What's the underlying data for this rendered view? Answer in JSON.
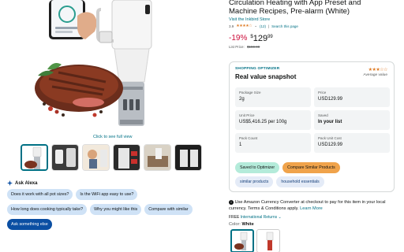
{
  "gallery": {
    "see_full_view": "Click to see full view",
    "thumbnail_count": 6
  },
  "ask": {
    "title": "Ask Alexa",
    "chips": [
      "Does it work with all pot sizes?",
      "Is the WiFi app easy to use?",
      "How long does cooking typically take?",
      "Why you might like this",
      "Compare with similar",
      "Ask something else"
    ]
  },
  "product": {
    "title_line1": "Circulation Heating with App Preset and",
    "title_line2": "Machine Recipes, Pre-alarm (White)",
    "store_link": "Visit the Inkbird Store",
    "rating_value": "3.9",
    "rating_count": "(12)",
    "search_page_link": "Search this page",
    "discount": "-19%",
    "price_symbol": "$",
    "price_whole": "129",
    "price_cents": "99",
    "list_price_label": "List Price:",
    "list_price": "$159.99"
  },
  "optimizer": {
    "label": "SHOPPING OPTIMIZER",
    "heading": "Real value snapshot",
    "rating_label": "Average value",
    "cells": [
      {
        "k": "Package Size",
        "v": "2g"
      },
      {
        "k": "Price",
        "v": "USD129.99"
      },
      {
        "k": "Unit Price",
        "v": "US$5,416.25 per 100g"
      },
      {
        "k": "Saved",
        "v": "In your list"
      },
      {
        "k": "Pack Count",
        "v": "1"
      },
      {
        "k": "Pack Unit Cost",
        "v": "USD129.99"
      }
    ],
    "saved_button": "Saved to Optimizer",
    "compare_button": "Compare Similar Products",
    "tags": [
      "similar products",
      "household essentials"
    ]
  },
  "currency": {
    "text": "Use Amazon Currency Converter at checkout to pay for this item in your local currency. Terms & Conditions apply.",
    "learn_more": "Learn More"
  },
  "returns": {
    "free": "FREE",
    "link": "International Returns"
  },
  "color": {
    "label": "Color:",
    "value": "White"
  },
  "colors": {
    "accent": "#007185",
    "price_red": "#cc0c39",
    "star": "#de7921",
    "chip_blue": "#cfe2f6",
    "chip_dark": "#0b4fa3"
  }
}
